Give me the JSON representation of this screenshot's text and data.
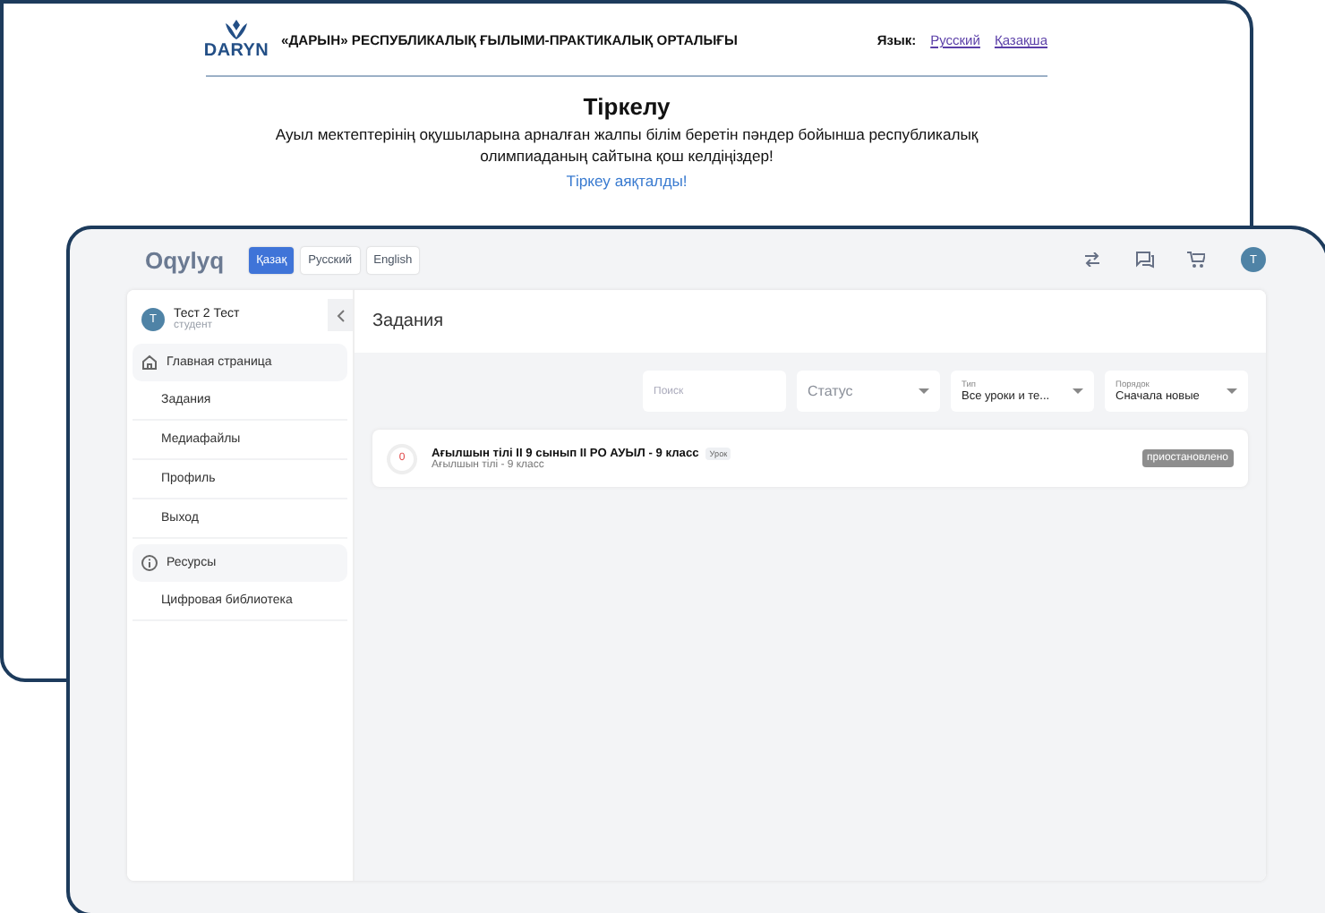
{
  "back_window": {
    "org_title": "«ДАРЫН» РЕСПУБЛИКАЛЫҚ ҒЫЛЫМИ-ПРАКТИКАЛЫҚ ОРТАЛЫҒЫ",
    "logo_text": "DARYN",
    "language_label": "Язык:",
    "languages": [
      {
        "label": "Русский"
      },
      {
        "label": "Қазақша"
      }
    ],
    "heading": "Тіркелу",
    "message": "Ауыл мектептерінің оқушыларына арналған жалпы білім беретін пәндер бойынша республикалық олимпиаданың сайтына қош келдіңіздер!",
    "status_link": "Тіркеу аяқталды!"
  },
  "app": {
    "logo": "Oqylyq",
    "languages": [
      {
        "label": "Қазақ",
        "selected": true
      },
      {
        "label": "Русский",
        "selected": false
      },
      {
        "label": "English",
        "selected": false
      }
    ],
    "avatar_letter": "T"
  },
  "sidebar": {
    "user": {
      "initial": "T",
      "name": "Тест 2 Тест",
      "role": "студент"
    },
    "items": [
      {
        "kind": "home",
        "label": "Главная страница"
      },
      {
        "kind": "link",
        "label": "Задания"
      },
      {
        "kind": "link",
        "label": "Медиафайлы"
      },
      {
        "kind": "link",
        "label": "Профиль"
      },
      {
        "kind": "link",
        "label": "Выход"
      },
      {
        "kind": "info",
        "label": "Ресурсы"
      },
      {
        "kind": "link",
        "label": "Цифровая библиотека"
      }
    ]
  },
  "page_title": "Задания",
  "filters": [
    {
      "kind": "search",
      "placeholder": "Поиск"
    },
    {
      "kind": "select",
      "placeholder": "Статус"
    },
    {
      "kind": "select",
      "label": "Тип",
      "value": "Все уроки и те..."
    },
    {
      "kind": "select",
      "label": "Порядок",
      "value": "Сначала новые"
    }
  ],
  "tasks": [
    {
      "score": "0",
      "title": "Ағылшын тілі II 9 сынып II РО АУЫЛ - 9 класс",
      "tag": "Урок",
      "subtitle": "Ағылшын тілі - 9 класс",
      "status": "приостановлено"
    }
  ]
}
